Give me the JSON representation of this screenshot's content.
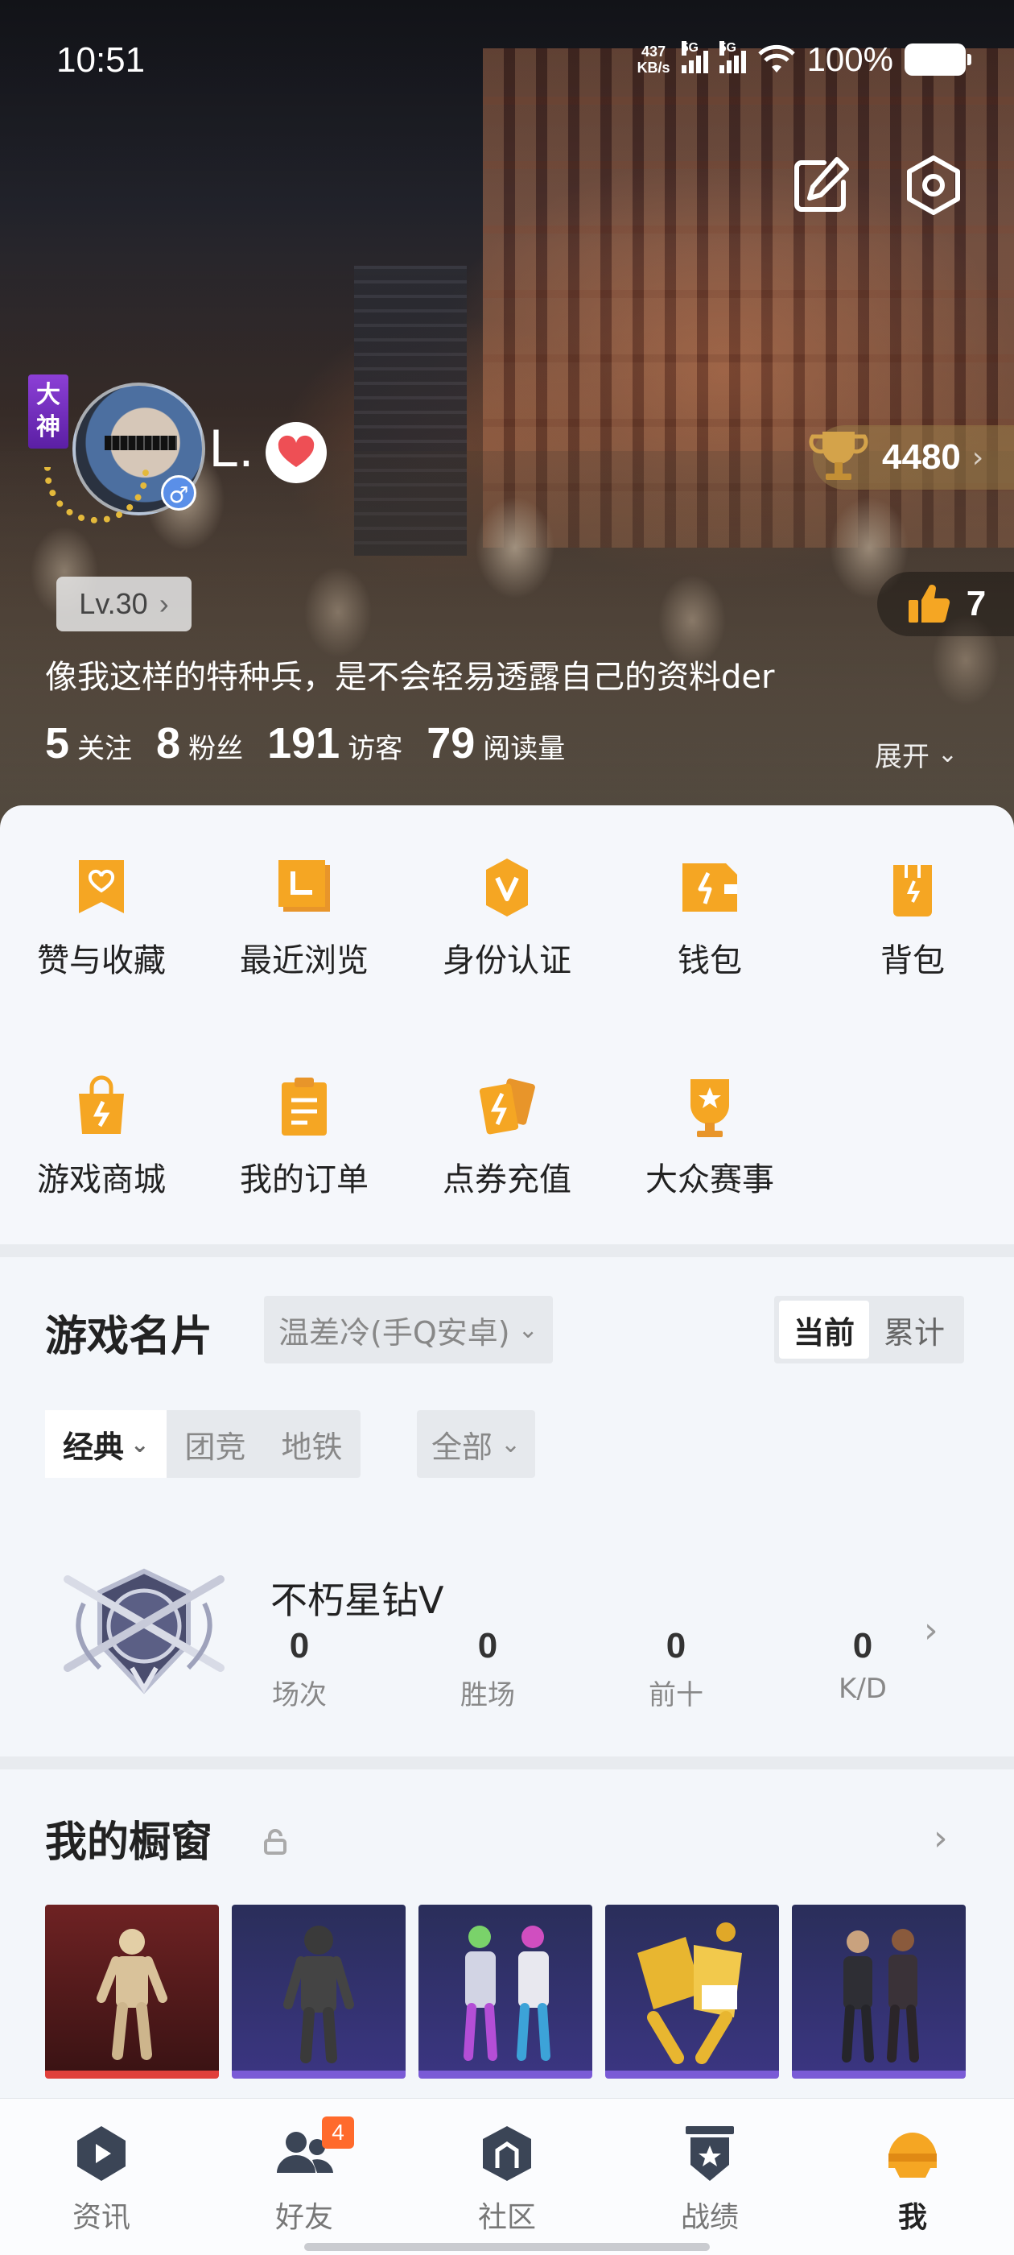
{
  "status_bar": {
    "time": "10:51",
    "net_speed_value": "437",
    "net_speed_unit": "KB/s",
    "signal1_tag": "5G",
    "signal2_tag": "5G",
    "battery": "100%"
  },
  "profile": {
    "god_badge": "大神",
    "gender_symbol": "♂",
    "nickname": "L.",
    "trophy_count": "4480",
    "level": "Lv.30",
    "like_count": "7",
    "bio": "像我这样的特种兵，是不会轻易透露自己的资料der",
    "stats": [
      {
        "value": "5",
        "label": "关注"
      },
      {
        "value": "8",
        "label": "粉丝"
      },
      {
        "value": "191",
        "label": "访客"
      },
      {
        "value": "79",
        "label": "阅读量"
      }
    ],
    "expand_label": "展开"
  },
  "services": [
    {
      "label": "赞与收藏",
      "icon": "heart-bookmark-icon"
    },
    {
      "label": "最近浏览",
      "icon": "history-folder-icon"
    },
    {
      "label": "身份认证",
      "icon": "verify-v-icon"
    },
    {
      "label": "钱包",
      "icon": "wallet-icon"
    },
    {
      "label": "背包",
      "icon": "backpack-icon"
    },
    {
      "label": "游戏商城",
      "icon": "shopping-bag-icon"
    },
    {
      "label": "我的订单",
      "icon": "clipboard-icon"
    },
    {
      "label": "点券充值",
      "icon": "recharge-cards-icon"
    },
    {
      "label": "大众赛事",
      "icon": "tournament-trophy-icon"
    }
  ],
  "game_card": {
    "title": "游戏名片",
    "account": "温差冷(手Q安卓)",
    "toggle": {
      "current": "当前",
      "total": "累计"
    },
    "modes": {
      "classic": "经典",
      "team": "团竞",
      "metro": "地铁"
    },
    "filter": "全部",
    "rank_name": "不朽星钻Ⅴ",
    "rank_stats": [
      {
        "value": "0",
        "label": "场次"
      },
      {
        "value": "0",
        "label": "胜场"
      },
      {
        "value": "0",
        "label": "前十"
      },
      {
        "value": "0",
        "label": "K/D"
      }
    ]
  },
  "showcase": {
    "title": "我的橱窗"
  },
  "bottom_nav": [
    {
      "label": "资讯",
      "icon": "news-play-icon"
    },
    {
      "label": "好友",
      "icon": "friends-icon",
      "badge": "4"
    },
    {
      "label": "社区",
      "icon": "community-icon"
    },
    {
      "label": "战绩",
      "icon": "battle-record-icon"
    },
    {
      "label": "我",
      "icon": "me-helmet-icon"
    }
  ],
  "colors": {
    "accent_orange": "#f5a623",
    "badge_orange": "#ff6a2c",
    "rarity_red": "#e0403b",
    "rarity_purple": "#7a5bd6"
  }
}
